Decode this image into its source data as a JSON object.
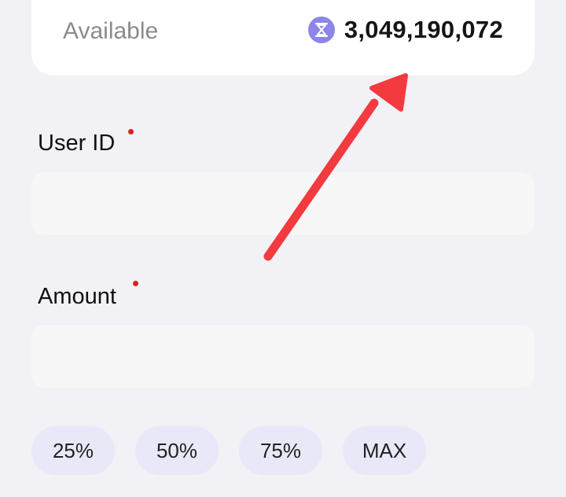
{
  "balance": {
    "label": "Available",
    "amount": "3,049,190,072",
    "icon": "hourglass-token-icon"
  },
  "form": {
    "user_id_label": "User ID",
    "amount_label": "Amount",
    "user_id_value": "",
    "amount_value": ""
  },
  "percent_buttons": [
    "25%",
    "50%",
    "75%",
    "MAX"
  ],
  "colors": {
    "background": "#f1f1f6",
    "accent": "#8d86e8",
    "required": "#d3261f",
    "annotation_arrow": "#f23a3f"
  }
}
